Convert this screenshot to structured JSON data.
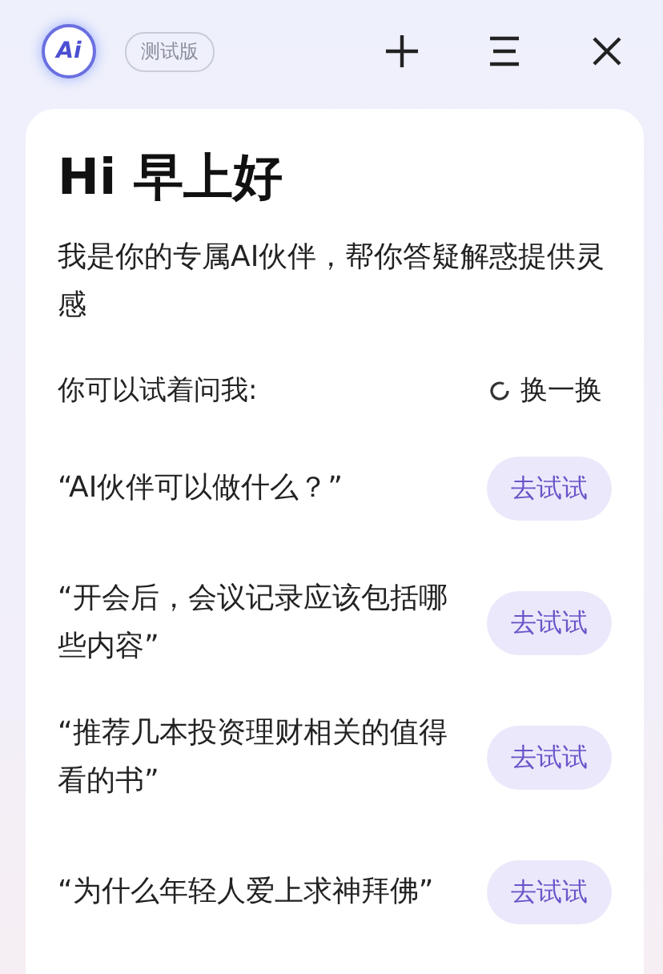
{
  "header": {
    "logo": "Ai",
    "badge": "测试版"
  },
  "card": {
    "greeting": "Hi 早上好",
    "intro": "我是你的专属AI伙伴，帮你答疑解惑提供灵感",
    "prompt_label": "你可以试着问我:",
    "refresh": "换一换",
    "suggestions": [
      {
        "question": "“AI伙伴可以做什么？”",
        "action": "去试试"
      },
      {
        "question": "“开会后，会议记录应该包括哪些内容”",
        "action": "去试试"
      },
      {
        "question": "“推荐几本投资理财相关的值得看的书”",
        "action": "去试试"
      },
      {
        "question": "“为什么年轻人爱上求神拜佛”",
        "action": "去试试"
      }
    ]
  }
}
